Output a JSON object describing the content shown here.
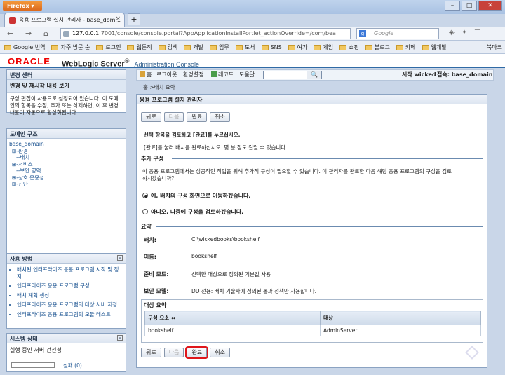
{
  "browser": {
    "app_button": "Firefox",
    "tab_title": "응용 프로그램 설치 관리자 - base_dom...",
    "url_host": "127.0.0.1",
    "url_rest": ":7001/console/console.portal?AppApplicationInstallPortlet_actionOverride=/com/bea",
    "search_placeholder": "Google",
    "bookmarks": [
      "Google 번역",
      "자주 방문 순",
      "로그인",
      "웹툰직",
      "검색",
      "개발",
      "업무",
      "도서",
      "SNS",
      "여가",
      "게임",
      "쇼핑",
      "블로그",
      "카페",
      "웹개발"
    ],
    "bookmarks_more": "북마크"
  },
  "header": {
    "brand": "ORACLE",
    "product": "WebLogic Server",
    "sub": "Administration Console"
  },
  "toplinks": {
    "home": "홈",
    "logout": "로그아웃",
    "prefs": "환경설정",
    "record": "레코드",
    "help": "도움말",
    "go": "🔍",
    "user": "시작 wicked",
    "conn": "접속: base_domain"
  },
  "breadcrumb": "홈 >배치 요약",
  "change_center": {
    "title": "변경 센터",
    "sub": "변경 및 재시작 내용 보기",
    "body": "구성 편집이 사용으로 설정되어 있습니다. 이 도메인의 항목을 수정, 추가 또는 삭제하면, 이 후 변경 내용이 자동으로 활성화됩니다."
  },
  "domain_tree": {
    "title": "도메인 구조",
    "root": "base_domain",
    "items": [
      {
        "label": "⊞-환경",
        "level": "node"
      },
      {
        "label": "--배치",
        "level": "node"
      },
      {
        "label": "⊞-서비스",
        "level": "node"
      },
      {
        "label": "--보안 영역",
        "level": "node"
      },
      {
        "label": "⊞-상호 운용성",
        "level": "node"
      },
      {
        "label": "⊞-진단",
        "level": "node"
      }
    ]
  },
  "howto": {
    "title": "사용 방법",
    "items": [
      "배치된 엔터프라이즈 응용 프로그램 시작 및 정지",
      "엔터프라이즈 응용 프로그램 구성",
      "배치 계획 생성",
      "엔터프라이즈 응용 프로그램의 대상 서버 지정",
      "엔터프라이즈 응용 프로그램의 모듈 테스트"
    ]
  },
  "system_status": {
    "title": "시스템 상태",
    "sub": "실행 중인 서버 건전성",
    "failed_label": "실패 (0)"
  },
  "main": {
    "title": "응용 프로그램 설치 관리자",
    "buttons": {
      "back": "뒤로",
      "next": "다음",
      "finish": "완료",
      "cancel": "취소"
    },
    "intro": "선택 항목을 검토하고 [완료]를 누르십시오.",
    "finish_note": "[완료]를 눌러 배치를 완료하십시오. 몇 분 정도 걸릴 수 있습니다.",
    "extra_config_title": "추가 구성",
    "extra_config_text": "이 응용 프로그램에서는 성공적인 작업을 위해 추가적 구성이 필요할 수 있습니다. 이 관리자를 완료한 다음 해당 응용 프로그램의 구성을 검토",
    "extra_config_text2": "하시겠습니까?",
    "radio_yes": "예, 배치의 구성 화면으로 이동하겠습니다.",
    "radio_no": "아니오, 나중에 구성을 검토하겠습니다.",
    "summary_title": "요약",
    "summary": [
      {
        "key": "배치:",
        "value": "C:\\wickedbooks\\bookshelf"
      },
      {
        "key": "이름:",
        "value": "bookshelf"
      },
      {
        "key": "준비 모드:",
        "value": "선택한 대상으로 정의된 기본값 사용"
      },
      {
        "key": "보안 모델:",
        "value": "DD 전용: 배치 기술자에 정의된 롤과 정책만 사용합니다."
      }
    ],
    "target_summary_title": "대상 요약",
    "table_headers": [
      "구성 요소 ⇔",
      "대상"
    ],
    "table_rows": [
      [
        "bookshelf",
        "AdminServer"
      ]
    ]
  }
}
